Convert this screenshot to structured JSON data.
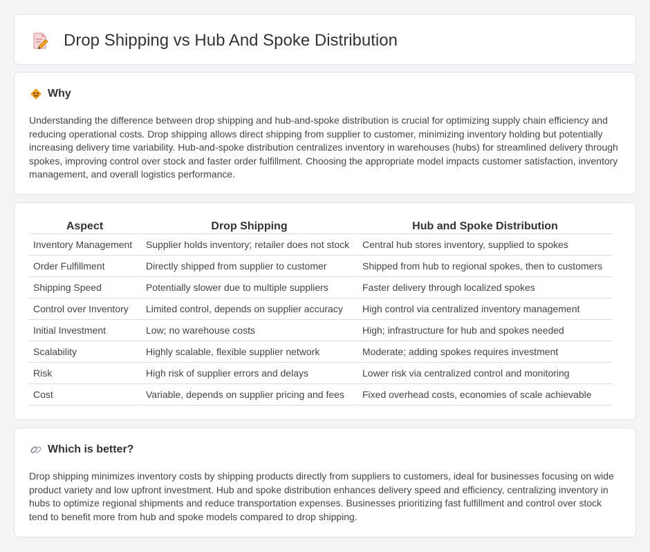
{
  "header": {
    "title": "Drop Shipping vs Hub And Spoke Distribution",
    "icon": "document-edit-icon"
  },
  "why": {
    "title": "Why",
    "icon": "diamond-warning-icon",
    "text": "Understanding the difference between drop shipping and hub-and-spoke distribution is crucial for optimizing supply chain efficiency and reducing operational costs. Drop shipping allows direct shipping from supplier to customer, minimizing inventory holding but potentially increasing delivery time variability. Hub-and-spoke distribution centralizes inventory in warehouses (hubs) for streamlined delivery through spokes, improving control over stock and faster order fulfillment. Choosing the appropriate model impacts customer satisfaction, inventory management, and overall logistics performance."
  },
  "table": {
    "headers": [
      "Aspect",
      "Drop Shipping",
      "Hub and Spoke Distribution"
    ],
    "rows": [
      [
        "Inventory Management",
        "Supplier holds inventory; retailer does not stock",
        "Central hub stores inventory, supplied to spokes"
      ],
      [
        "Order Fulfillment",
        "Directly shipped from supplier to customer",
        "Shipped from hub to regional spokes, then to customers"
      ],
      [
        "Shipping Speed",
        "Potentially slower due to multiple suppliers",
        "Faster delivery through localized spokes"
      ],
      [
        "Control over Inventory",
        "Limited control, depends on supplier accuracy",
        "High control via centralized inventory management"
      ],
      [
        "Initial Investment",
        "Low; no warehouse costs",
        "High; infrastructure for hub and spokes needed"
      ],
      [
        "Scalability",
        "Highly scalable, flexible supplier network",
        "Moderate; adding spokes requires investment"
      ],
      [
        "Risk",
        "High risk of supplier errors and delays",
        "Lower risk via centralized control and monitoring"
      ],
      [
        "Cost",
        "Variable, depends on supplier pricing and fees",
        "Fixed overhead costs, economies of scale achievable"
      ]
    ]
  },
  "better": {
    "title": "Which is better?",
    "icon": "link-icon",
    "text": "Drop shipping minimizes inventory costs by shipping products directly from suppliers to customers, ideal for businesses focusing on wide product variety and low upfront investment. Hub and spoke distribution enhances delivery speed and efficiency, centralizing inventory in hubs to optimize regional shipments and reduce transportation expenses. Businesses prioritizing fast fulfillment and control over stock tend to benefit more from hub and spoke models compared to drop shipping."
  },
  "colors": {
    "page_background": "#f4f4f6",
    "card_background": "#ffffff",
    "icon_orange": "#f0a020",
    "icon_pink": "#e9a1a8"
  }
}
